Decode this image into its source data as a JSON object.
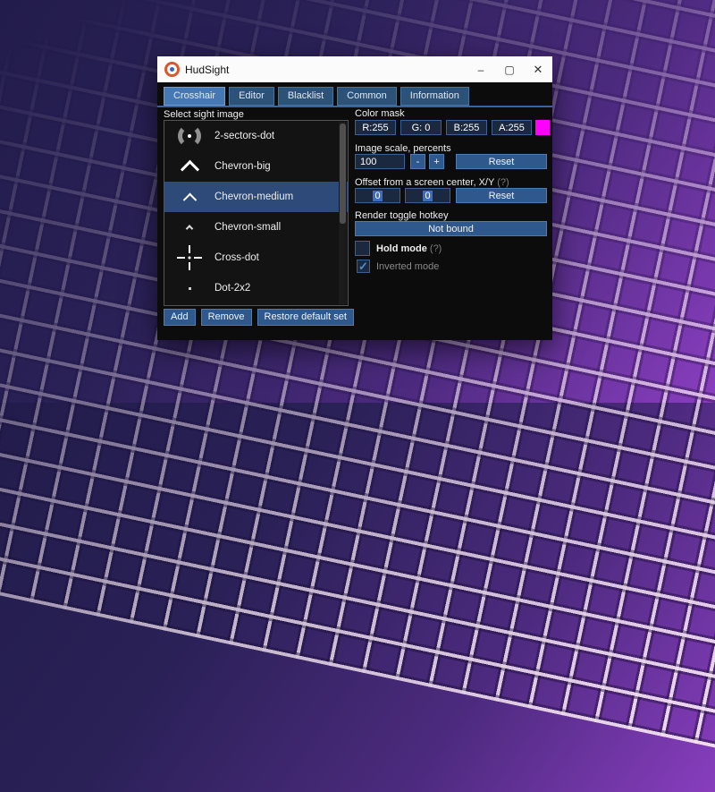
{
  "background": {
    "style": "purple-synthwave-grid",
    "base_colors": [
      "#221c4b",
      "#2a2157",
      "#4c2a7e",
      "#8a3ec0"
    ],
    "grid_line_color": "#fff0f8"
  },
  "window": {
    "title": "HudSight",
    "titlebar": {
      "minimize_glyph": "–",
      "maximize_glyph": "▢",
      "close_glyph": "✕"
    },
    "tabs": [
      {
        "label": "Crosshair",
        "selected": true
      },
      {
        "label": "Editor",
        "selected": false
      },
      {
        "label": "Blacklist",
        "selected": false
      },
      {
        "label": "Common",
        "selected": false
      },
      {
        "label": "Information",
        "selected": false
      }
    ],
    "crosshair_tab": {
      "list_label": "Select sight image",
      "sight_list": [
        {
          "name": "2-sectors-dot",
          "icon": "sectors-dot-icon",
          "selected": false
        },
        {
          "name": "Chevron-big",
          "icon": "chevron-big-icon",
          "selected": false
        },
        {
          "name": "Chevron-medium",
          "icon": "chevron-medium-icon",
          "selected": true
        },
        {
          "name": "Chevron-small",
          "icon": "chevron-small-icon",
          "selected": false
        },
        {
          "name": "Cross-dot",
          "icon": "cross-dot-icon",
          "selected": false
        },
        {
          "name": "Dot-2x2",
          "icon": "dot-2x2-icon",
          "selected": false
        }
      ],
      "list_buttons": {
        "add": "Add",
        "remove": "Remove",
        "restore": "Restore default set"
      },
      "color_mask": {
        "label": "Color mask",
        "r": "R:255",
        "g": "G: 0",
        "b": "B:255",
        "a": "A:255",
        "swatch_color": "#ff00ff"
      },
      "image_scale": {
        "label": "Image scale, percents",
        "value": "100",
        "minus": "-",
        "plus": "+",
        "reset": "Reset"
      },
      "offset": {
        "label": "Offset from a screen center, X/Y",
        "help": "(?)",
        "x": "0",
        "y": "0",
        "reset": "Reset"
      },
      "hotkey": {
        "label": "Render toggle hotkey",
        "button": "Not bound"
      },
      "hold_mode": {
        "label": "Hold mode",
        "help": "(?)",
        "checked": false
      },
      "inverted_mode": {
        "label": "Inverted mode",
        "checked": true,
        "check_glyph": "✓"
      }
    }
  }
}
